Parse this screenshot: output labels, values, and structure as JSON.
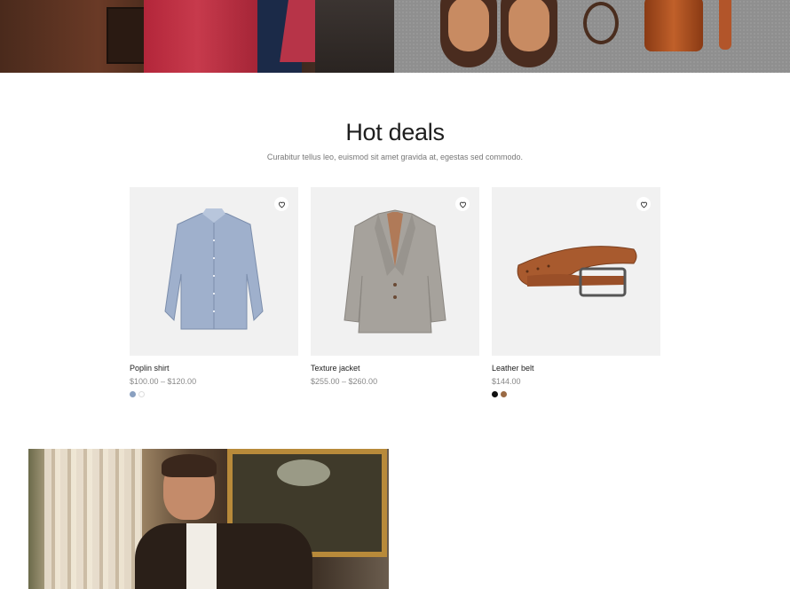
{
  "section": {
    "title": "Hot deals",
    "subtitle": "Curabitur tellus leo, euismod sit amet gravida at, egestas sed commodo."
  },
  "products": [
    {
      "name": "Poplin shirt",
      "price": "$100.00 – $120.00",
      "image": "shirt",
      "wishlist_icon": "heart-icon",
      "swatches": [
        "#8aa0c0",
        "#ffffff"
      ]
    },
    {
      "name": "Texture jacket",
      "price": "$255.00 – $260.00",
      "image": "jacket",
      "wishlist_icon": "heart-icon",
      "swatches": []
    },
    {
      "name": "Leather belt",
      "price": "$144.00",
      "image": "belt",
      "wishlist_icon": "heart-icon",
      "swatches": [
        "#111111",
        "#9a6a44"
      ]
    }
  ],
  "colors": {
    "card_background": "#f1f1f1",
    "price_text": "#888888"
  }
}
